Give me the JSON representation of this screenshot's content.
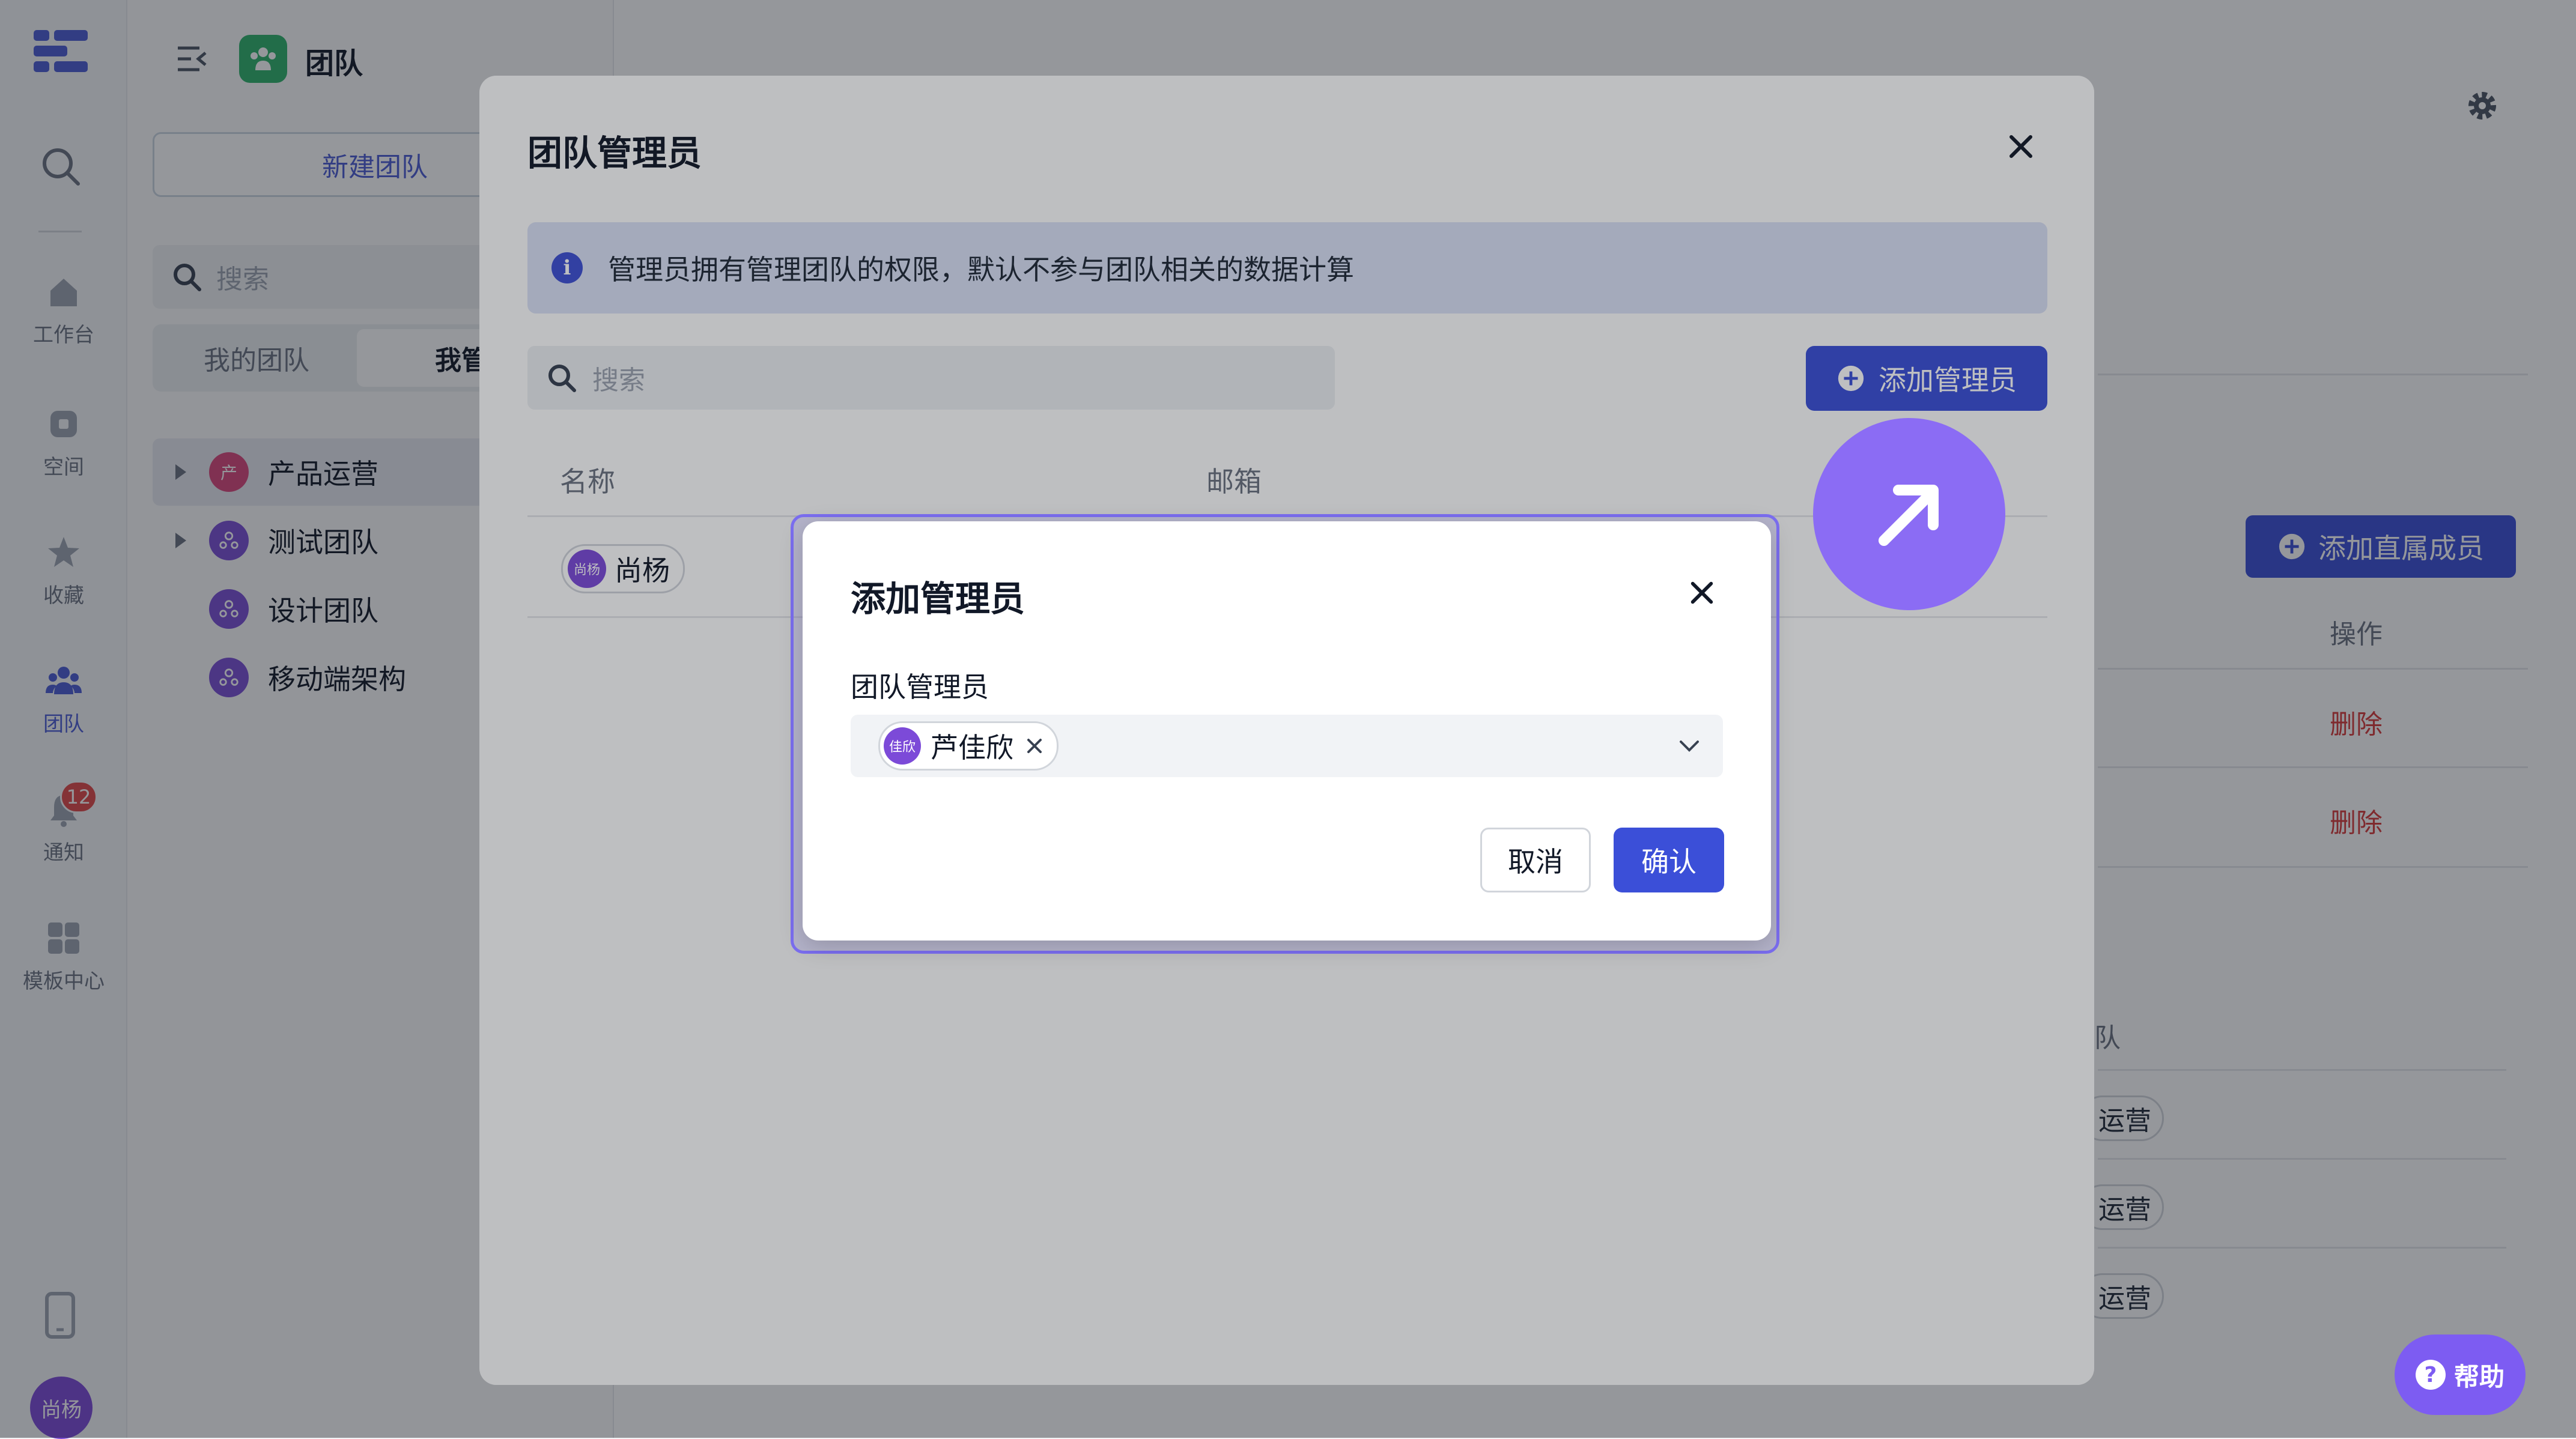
{
  "rail": {
    "items": [
      {
        "label": "工作台",
        "icon": "home-icon"
      },
      {
        "label": "空间",
        "icon": "space-icon"
      },
      {
        "label": "收藏",
        "icon": "star-icon"
      },
      {
        "label": "团队",
        "icon": "team-icon"
      },
      {
        "label": "通知",
        "icon": "bell-icon",
        "badge": "12"
      },
      {
        "label": "模板中心",
        "icon": "template-icon"
      }
    ],
    "user_avatar": "尚杨"
  },
  "team_panel": {
    "title": "团队",
    "new_team_label": "新建团队",
    "search_placeholder": "搜索",
    "tabs": [
      {
        "label": "我的团队"
      },
      {
        "label": "我管理"
      }
    ],
    "teams": [
      {
        "name": "产品运营",
        "avatar": "产",
        "color": "#d9467a"
      },
      {
        "name": "测试团队",
        "avatar": "",
        "color": "#7a4fd6"
      },
      {
        "name": "设计团队",
        "avatar": "",
        "color": "#7a4fd6"
      },
      {
        "name": "移动端架构",
        "avatar": "",
        "color": "#7a4fd6"
      }
    ]
  },
  "background": {
    "add_direct_member_label": "添加直属成员",
    "ops_header": "操作",
    "delete_label": "删除",
    "team_header_partial": "队",
    "team_chip_partial": "运营"
  },
  "admin_modal": {
    "title": "团队管理员",
    "info_text": "管理员拥有管理团队的权限，默认不参与团队相关的数据计算",
    "search_placeholder": "搜索",
    "add_admin_label": "添加管理员",
    "columns": {
      "name": "名称",
      "email": "邮箱"
    },
    "rows": [
      {
        "name": "尚杨",
        "avatar": "尚杨"
      }
    ]
  },
  "add_admin_dialog": {
    "title": "添加管理员",
    "field_label": "团队管理员",
    "selected": [
      {
        "name": "芦佳欣",
        "avatar": "佳欣"
      }
    ],
    "cancel_label": "取消",
    "confirm_label": "确认"
  },
  "help_label": "帮助",
  "colors": {
    "primary": "#3b4fd8",
    "accent": "#7d5cf2",
    "danger": "#d83a3a"
  }
}
